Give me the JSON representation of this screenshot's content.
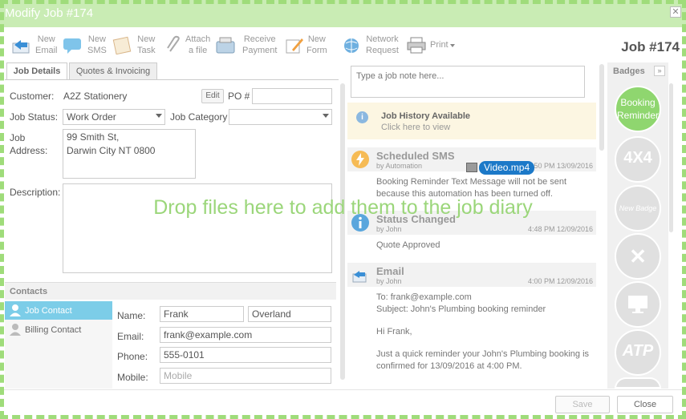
{
  "window": {
    "title": "Modify Job #174",
    "job_number": "Job #174"
  },
  "toolbar": {
    "new_email": "New\nEmail",
    "new_sms": "New\nSMS",
    "new_task": "New\nTask",
    "attach_file": "Attach\na file",
    "receive_payment": "Receive\nPayment",
    "new_form": "New\nForm",
    "network_request": "Network\nRequest",
    "print": "Print"
  },
  "tabs": {
    "job_details": "Job Details",
    "quotes": "Quotes & Invoicing"
  },
  "form": {
    "customer_label": "Customer:",
    "customer_value": "A2Z Stationery",
    "edit_label": "Edit",
    "po_label": "PO #",
    "po_value": "",
    "status_label": "Job Status:",
    "status_value": "Work Order",
    "category_label": "Job Category",
    "category_value": "",
    "address_label_1": "Job",
    "address_label_2": "Address:",
    "address_line_1": "99 Smith St,",
    "address_line_2": "Darwin City NT 0800",
    "description_label": "Description:"
  },
  "contacts": {
    "header": "Contacts",
    "job_contact": "Job Contact",
    "billing_contact": "Billing Contact",
    "name_label": "Name:",
    "first_name": "Frank",
    "last_name": "Overland",
    "email_label": "Email:",
    "email_value": "frank@example.com",
    "phone_label": "Phone:",
    "phone_value": "555-0101",
    "mobile_label": "Mobile:",
    "mobile_placeholder": "Mobile"
  },
  "diary": {
    "note_placeholder": "Type a job note here...",
    "history_title": "Job History Available",
    "history_link": "Click here to view",
    "entries": [
      {
        "title": "Scheduled SMS",
        "by": "by Automation",
        "date": "4:50 PM 13/09/2016",
        "body": "Booking Reminder Text Message will not be sent because this automation has been turned off."
      },
      {
        "title": "Status Changed",
        "by": "by John",
        "date": "4:48 PM 12/09/2016",
        "body": "Quote Approved"
      },
      {
        "title": "Email",
        "by": "by John",
        "date": "4:00 PM 12/09/2016",
        "to": "To: frank@example.com",
        "subject": "Subject: John's Plumbing booking reminder",
        "greeting": "Hi Frank,",
        "para": "Just a quick reminder your John's Plumbing booking is confirmed for 13/09/2016 at 4:00 PM."
      }
    ]
  },
  "drag": {
    "file_name": "Video.mp4",
    "drop_hint": "Drop files here to add them to the job diary"
  },
  "badges": {
    "header": "Badges",
    "expand": "»",
    "booking_reminder": "Booking\nReminder",
    "four_by_four": "4X4",
    "new_badge": "New Badge",
    "cross": "✕",
    "atp": "ATP"
  },
  "footer": {
    "save": "Save",
    "close": "Close"
  },
  "colors": {
    "accent_green": "#9fdc7a",
    "active_blue": "#7ccde8",
    "chip_blue": "#1c79c8"
  }
}
